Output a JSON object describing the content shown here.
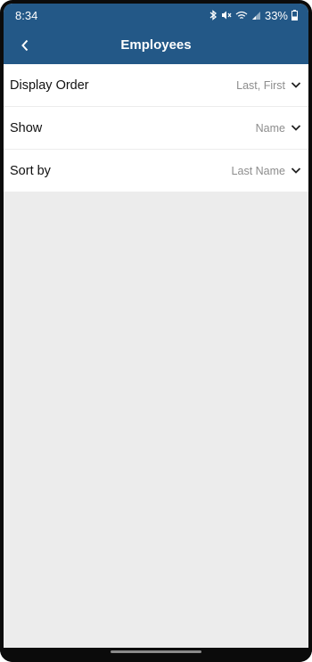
{
  "status_bar": {
    "time": "8:34",
    "battery": "33%",
    "icons": [
      "bluetooth-icon",
      "mute-icon",
      "wifi-icon",
      "signal-icon",
      "battery-icon"
    ]
  },
  "header": {
    "title": "Employees",
    "back_icon": "chevron-left-icon"
  },
  "settings": [
    {
      "label": "Display Order",
      "value": "Last, First"
    },
    {
      "label": "Show",
      "value": "Name"
    },
    {
      "label": "Sort by",
      "value": "Last Name"
    }
  ],
  "colors": {
    "header": "#235887",
    "background": "#ececec",
    "row_bg": "#ffffff",
    "value_text": "#8d8d8d"
  }
}
